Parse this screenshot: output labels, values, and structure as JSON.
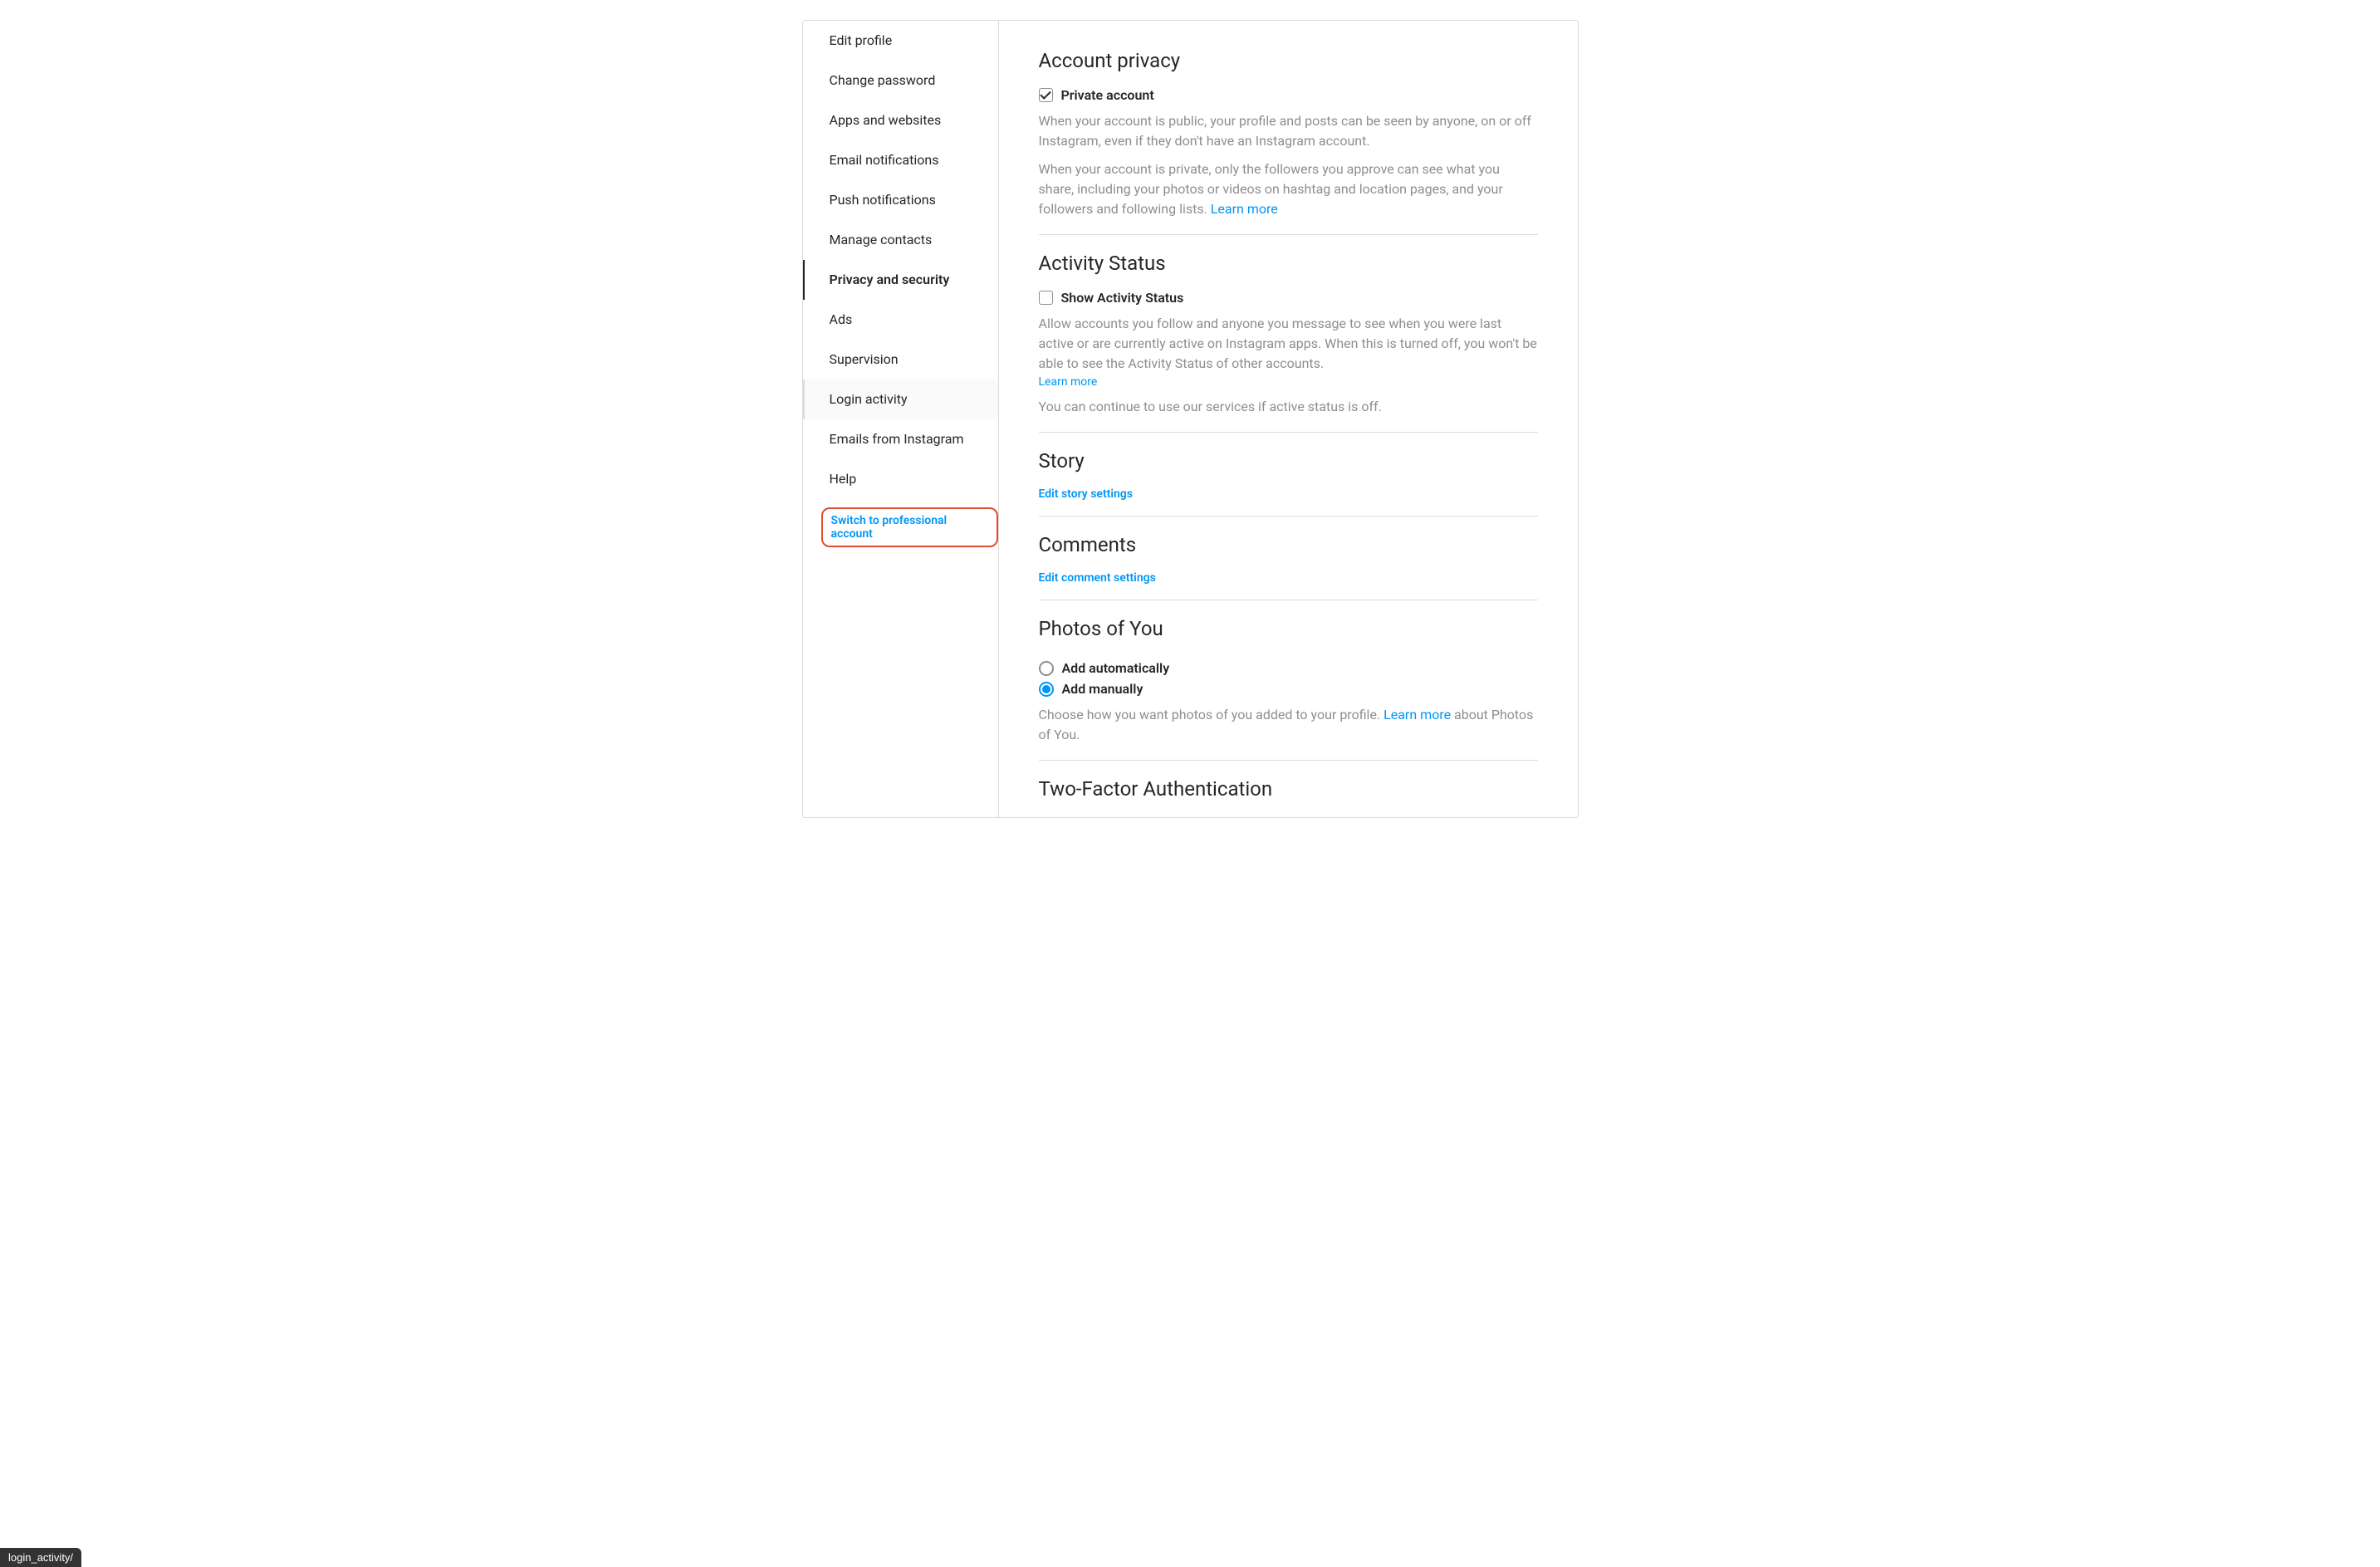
{
  "sidebar": {
    "items": [
      {
        "label": "Edit profile"
      },
      {
        "label": "Change password"
      },
      {
        "label": "Apps and websites"
      },
      {
        "label": "Email notifications"
      },
      {
        "label": "Push notifications"
      },
      {
        "label": "Manage contacts"
      },
      {
        "label": "Privacy and security"
      },
      {
        "label": "Ads"
      },
      {
        "label": "Supervision"
      },
      {
        "label": "Login activity"
      },
      {
        "label": "Emails from Instagram"
      },
      {
        "label": "Help"
      }
    ],
    "switch_label": "Switch to professional account"
  },
  "sections": {
    "account_privacy": {
      "title": "Account privacy",
      "checkbox_label": "Private account",
      "checkbox_checked": true,
      "desc1": "When your account is public, your profile and posts can be seen by anyone, on or off Instagram, even if they don't have an Instagram account.",
      "desc2": "When your account is private, only the followers you approve can see what you share, including your photos or videos on hashtag and location pages, and your followers and following lists. ",
      "learn_more": "Learn more"
    },
    "activity_status": {
      "title": "Activity Status",
      "checkbox_label": "Show Activity Status",
      "checkbox_checked": false,
      "desc1": "Allow accounts you follow and anyone you message to see when you were last active or are currently active on Instagram apps. When this is turned off, you won't be able to see the Activity Status of other accounts.",
      "learn_more": "Learn more",
      "desc2": "You can continue to use our services if active status is off."
    },
    "story": {
      "title": "Story",
      "link": "Edit story settings"
    },
    "comments": {
      "title": "Comments",
      "link": "Edit comment settings"
    },
    "photos_of_you": {
      "title": "Photos of You",
      "option1": "Add automatically",
      "option2": "Add manually",
      "selected": "manual",
      "desc_prefix": "Choose how you want photos of you added to your profile. ",
      "learn_more": "Learn more",
      "desc_suffix": " about Photos of You."
    },
    "two_factor": {
      "title": "Two-Factor Authentication"
    }
  },
  "status_bar": "login_activity/"
}
